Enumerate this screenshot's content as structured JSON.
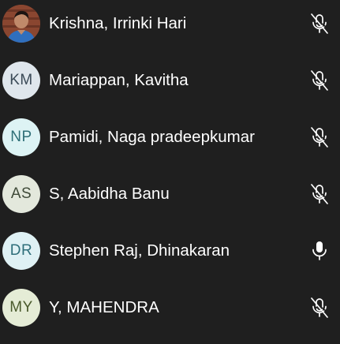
{
  "participants": [
    {
      "name": "Krishna, Irrinki Hari",
      "initials": "",
      "avatar_type": "photo",
      "avatar_bg": "#7a3d28",
      "avatar_fg": "#ffffff",
      "muted": true,
      "mic_icon": "mic-off-icon"
    },
    {
      "name": "Mariappan, Kavitha",
      "initials": "KM",
      "avatar_type": "initials",
      "avatar_bg": "#dfe6ec",
      "avatar_fg": "#3b4a57",
      "muted": true,
      "mic_icon": "mic-off-icon"
    },
    {
      "name": "Pamidi, Naga pradeepkumar",
      "initials": "NP",
      "avatar_type": "initials",
      "avatar_bg": "#ddf3f4",
      "avatar_fg": "#2f6f77",
      "muted": true,
      "mic_icon": "mic-off-icon"
    },
    {
      "name": "S, Aabidha Banu",
      "initials": "AS",
      "avatar_type": "initials",
      "avatar_bg": "#e3e8dc",
      "avatar_fg": "#3f4a38",
      "muted": true,
      "mic_icon": "mic-off-icon"
    },
    {
      "name": "Stephen Raj, Dhinakaran",
      "initials": "DR",
      "avatar_type": "initials",
      "avatar_bg": "#dff1f4",
      "avatar_fg": "#2f6f7a",
      "muted": false,
      "mic_icon": "mic-icon"
    },
    {
      "name": "Y, MAHENDRA",
      "initials": "MY",
      "avatar_type": "initials",
      "avatar_bg": "#e5ecd6",
      "avatar_fg": "#4a5a2c",
      "muted": true,
      "mic_icon": "mic-off-icon"
    }
  ],
  "colors": {
    "background": "#1f1f1f",
    "text": "#ffffff",
    "icon": "#ffffff"
  }
}
